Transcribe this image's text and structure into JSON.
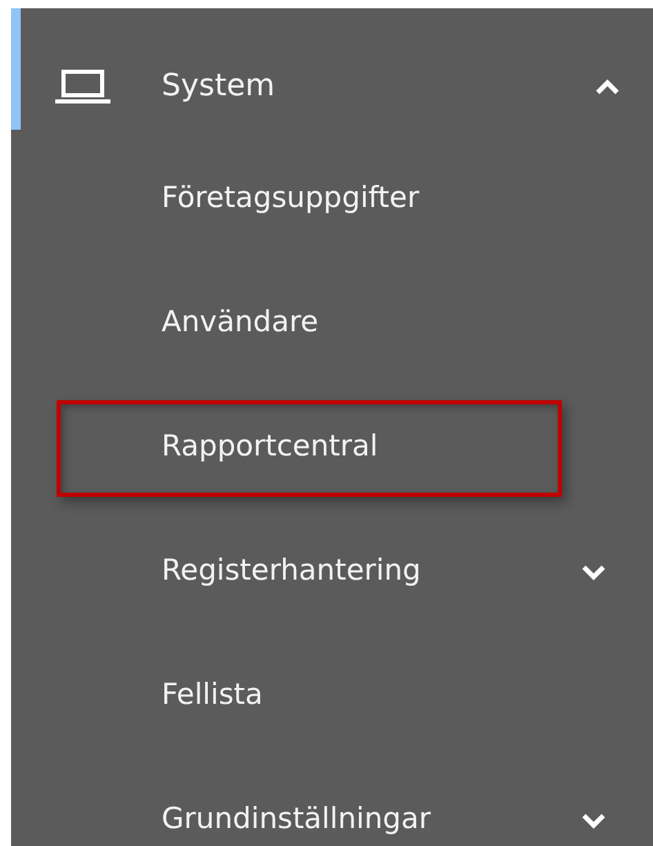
{
  "menu": {
    "title": "System",
    "expanded": true,
    "items": [
      {
        "label": "Företagsuppgifter",
        "highlighted": false
      },
      {
        "label": "Användare",
        "highlighted": false
      },
      {
        "label": "Rapportcentral",
        "highlighted": true
      },
      {
        "label": "Registerhantering",
        "highlighted": false,
        "expandable": true,
        "expanded": false
      },
      {
        "label": "Fellista",
        "highlighted": false
      },
      {
        "label": "Grundinställningar",
        "highlighted": false,
        "expandable": true,
        "expanded": false
      }
    ]
  }
}
